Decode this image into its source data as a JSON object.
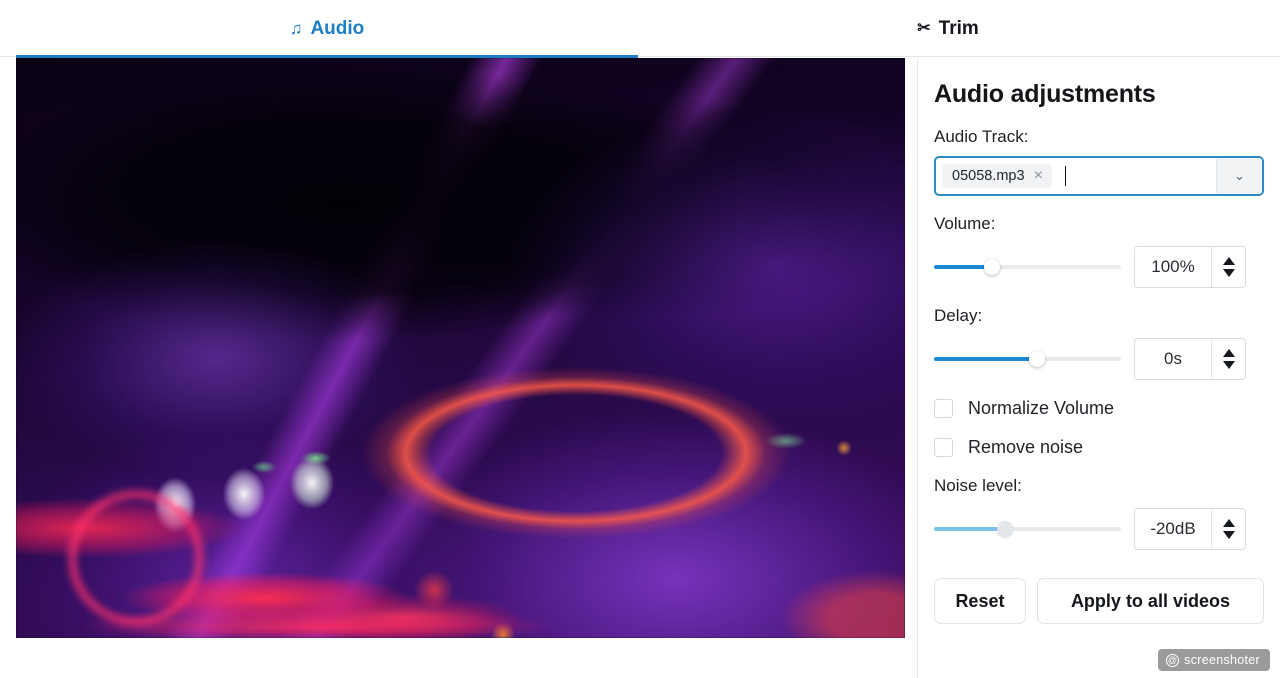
{
  "tabs": [
    {
      "id": "audio",
      "label": "Audio",
      "icon": "music-note-icon",
      "glyph": "♫",
      "active": true
    },
    {
      "id": "trim",
      "label": "Trim",
      "icon": "scissors-icon",
      "glyph": "✂",
      "active": false
    }
  ],
  "preview": {
    "alt": "DJ mixer with neon purple and pink lighting, hand over controller"
  },
  "panel": {
    "title": "Audio adjustments",
    "audio_track": {
      "label": "Audio Track:",
      "chips": [
        {
          "name": "05058.mp3",
          "remove_glyph": "×"
        }
      ],
      "caret_glyph": "⌄",
      "placeholder": ""
    },
    "volume": {
      "label": "Volume:",
      "value": "100%",
      "slider_percent": 31
    },
    "delay": {
      "label": "Delay:",
      "value": "0s",
      "slider_percent": 55
    },
    "checkboxes": [
      {
        "id": "normalize",
        "label": "Normalize Volume",
        "checked": false
      },
      {
        "id": "remove_noise",
        "label": "Remove noise",
        "checked": false
      }
    ],
    "noise_level": {
      "label": "Noise level:",
      "value": "-20dB",
      "slider_percent": 38,
      "muted": true
    },
    "buttons": {
      "reset": "Reset",
      "apply_all": "Apply to all videos"
    }
  },
  "watermark": {
    "at_glyph": "@",
    "text": "screenshoter"
  },
  "colors": {
    "accent": "#1d7fc3",
    "slider_active": "#1b8ad4",
    "slider_muted": "#7cc4ea",
    "track": "#e9ecef",
    "text": "#14161a",
    "border": "#d8dbe0",
    "focus_border": "#2b8cc4"
  }
}
